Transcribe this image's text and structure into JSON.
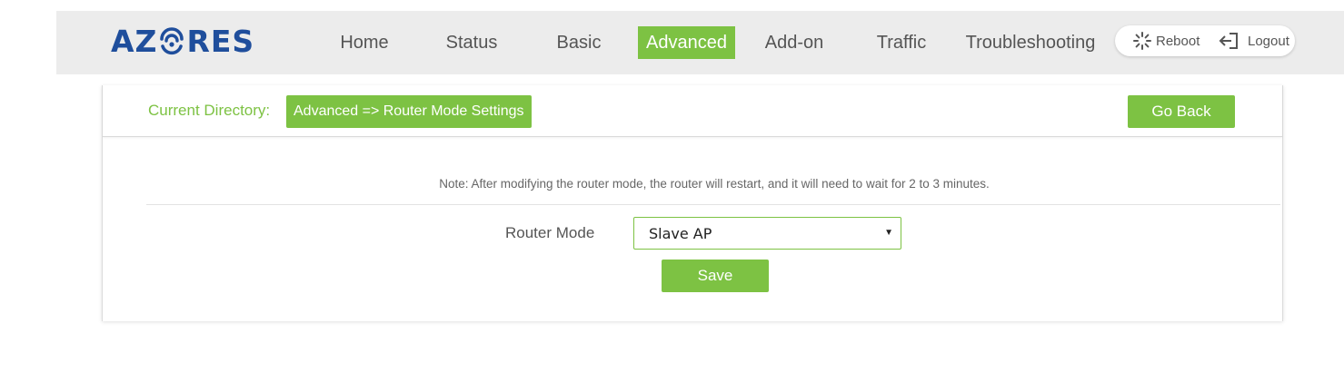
{
  "brand": {
    "name_prefix": "AZ",
    "name_suffix": "RES"
  },
  "nav": [
    {
      "label": "Home"
    },
    {
      "label": "Status"
    },
    {
      "label": "Basic"
    },
    {
      "label": "Advanced",
      "active": true
    },
    {
      "label": "Add-on"
    },
    {
      "label": "Traffic"
    },
    {
      "label": "Troubleshooting"
    }
  ],
  "actions": {
    "reboot_label": "Reboot",
    "logout_label": "Logout"
  },
  "directory": {
    "label": "Current Directory:",
    "value": "Advanced => Router Mode Settings",
    "go_back_label": "Go Back"
  },
  "form": {
    "note": "Note: After modifying the router mode, the router will restart, and it will need to wait for 2 to 3 minutes.",
    "router_mode_label": "Router Mode",
    "router_mode_value": "Slave AP",
    "save_label": "Save"
  },
  "colors": {
    "accent": "#7dc243",
    "brand": "#1f4e9c",
    "topbar": "#ececec"
  },
  "icons": {
    "reboot": "loading-spinner-icon",
    "logout": "logout-icon",
    "dropdown": "caret-down-icon"
  }
}
